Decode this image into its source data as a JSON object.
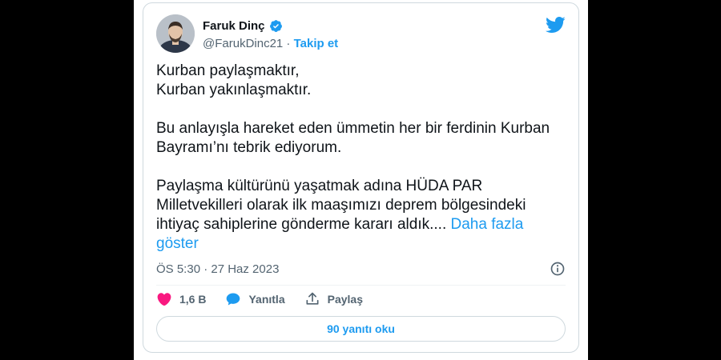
{
  "colors": {
    "accent": "#1d9bf0",
    "text": "#0f1419",
    "muted": "#536471",
    "heart": "#f91880",
    "border": "#cfd9de"
  },
  "author": {
    "display_name": "Faruk Dinç",
    "handle": "@FarukDinc21",
    "follow_label": "Takip et"
  },
  "tweet": {
    "line1": "Kurban paylaşmaktır,",
    "line2": "Kurban yakınlaşmaktır.",
    "paragraph2": "Bu anlayışla hareket eden ümmetin her bir ferdinin Kurban Bayramı’nı tebrik ediyorum.",
    "paragraph3": "Paylaşma kültürünü yaşatmak adına HÜDA PAR Milletvekilleri olarak ilk maaşımızı deprem bölgesindeki ihtiyaç sahiplerine gönderme kararı aldık....",
    "show_more": "Daha fazla göster"
  },
  "meta": {
    "timestamp": "ÖS 5:30 · 27 Haz 2023"
  },
  "actions": {
    "like_count": "1,6 B",
    "reply_label": "Yanıtla",
    "share_label": "Paylaş"
  },
  "read_replies_label": "90 yanıtı oku",
  "icons": [
    "verified-badge-icon",
    "twitter-bird-icon",
    "info-icon",
    "heart-icon",
    "reply-icon",
    "share-icon"
  ]
}
